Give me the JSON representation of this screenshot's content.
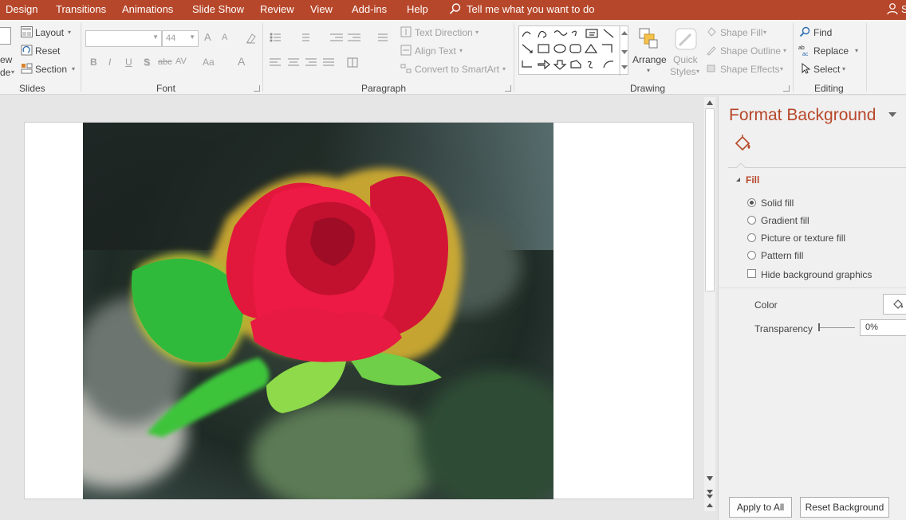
{
  "tabs": [
    "Design",
    "Transitions",
    "Animations",
    "Slide Show",
    "Review",
    "View",
    "Add-ins",
    "Help"
  ],
  "tell_me": "Tell me what you want to do",
  "user_initial": "S",
  "slides_group": {
    "new_slide_partial": "ew",
    "slide_partial": "de",
    "layout": "Layout",
    "reset": "Reset",
    "section": "Section",
    "label": "Slides"
  },
  "font_group": {
    "font_name": "",
    "font_size": "44",
    "bold": "B",
    "italic": "I",
    "underline": "U",
    "shadow": "S",
    "strike": "abc",
    "spacing": "AV",
    "case": "Aa",
    "color": "A",
    "grow": "A",
    "shrink": "A",
    "label": "Font"
  },
  "paragraph_group": {
    "text_direction": "Text Direction",
    "align_text": "Align Text",
    "smartart": "Convert to SmartArt",
    "label": "Paragraph"
  },
  "drawing_group": {
    "arrange": "Arrange",
    "quick_styles_1": "Quick",
    "quick_styles_2": "Styles",
    "shape_fill": "Shape Fill",
    "shape_outline": "Shape Outline",
    "shape_effects": "Shape Effects",
    "label": "Drawing"
  },
  "editing_group": {
    "find": "Find",
    "replace": "Replace",
    "select": "Select",
    "label": "Editing"
  },
  "pane": {
    "title": "Format Background",
    "fill_section": "Fill",
    "solid_fill": "Solid fill",
    "gradient_fill": "Gradient fill",
    "picture_fill": "Picture or texture fill",
    "pattern_fill": "Pattern fill",
    "hide_graphics": "Hide background graphics",
    "color_label": "Color",
    "transparency_label": "Transparency",
    "transparency_value": "0%",
    "apply_all": "Apply to All",
    "reset_background": "Reset Background"
  },
  "colors": {
    "accent": "#b7472a",
    "ribbon": "#f3f3f3",
    "pane": "#f0f0f0"
  },
  "icons": [
    "search-icon",
    "user-icon",
    "paint-bucket-icon",
    "find-icon",
    "replace-icon",
    "select-icon"
  ]
}
